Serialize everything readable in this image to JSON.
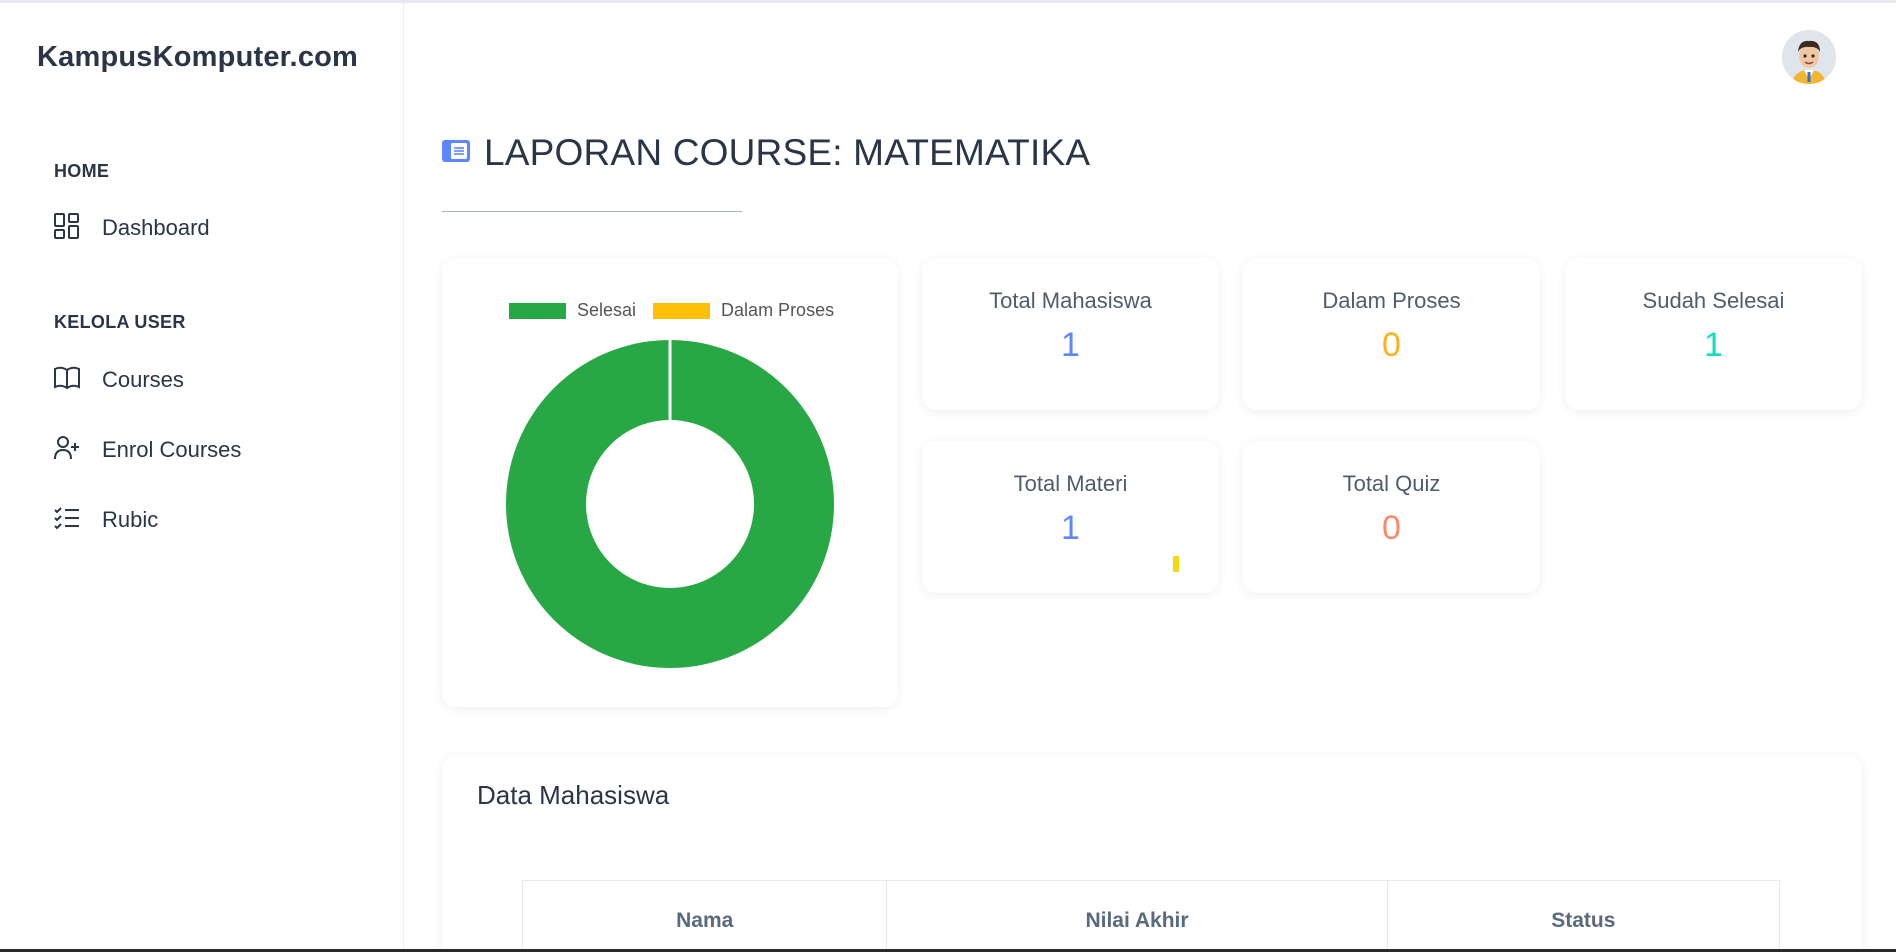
{
  "brand": "KampusKomputer.com",
  "sidebar": {
    "sections": [
      {
        "label": "HOME"
      },
      {
        "label": "KELOLA USER"
      }
    ],
    "items": [
      {
        "label": "Dashboard",
        "icon": "dashboard-icon"
      },
      {
        "label": "Courses",
        "icon": "book-icon"
      },
      {
        "label": "Enrol Courses",
        "icon": "user-plus-icon"
      },
      {
        "label": "Rubic",
        "icon": "checklist-icon"
      }
    ]
  },
  "header": {
    "avatar_icon": "avatar-icon"
  },
  "page": {
    "title": "LAPORAN COURSE: MATEMATIKA",
    "title_icon": "report-icon"
  },
  "stats": {
    "total_mahasiswa": {
      "label": "Total Mahasiswa",
      "value": "1",
      "color": "#5d87ff"
    },
    "dalam_proses": {
      "label": "Dalam Proses",
      "value": "0",
      "color": "#ffae1f"
    },
    "sudah_selesai": {
      "label": "Sudah Selesai",
      "value": "1",
      "color": "#13deb9"
    },
    "total_materi": {
      "label": "Total Materi",
      "value": "1",
      "color": "#5d87ff"
    },
    "total_quiz": {
      "label": "Total Quiz",
      "value": "0",
      "color": "#fa896b"
    }
  },
  "chart_data": {
    "type": "pie",
    "categories": [
      "Selesai",
      "Dalam Proses"
    ],
    "values": [
      1,
      0
    ],
    "colors": [
      "#28a745",
      "#ffc107"
    ],
    "legend": "top"
  },
  "data_section": {
    "title": "Data Mahasiswa",
    "columns": [
      "Nama",
      "Nilai Akhir",
      "Status"
    ]
  }
}
